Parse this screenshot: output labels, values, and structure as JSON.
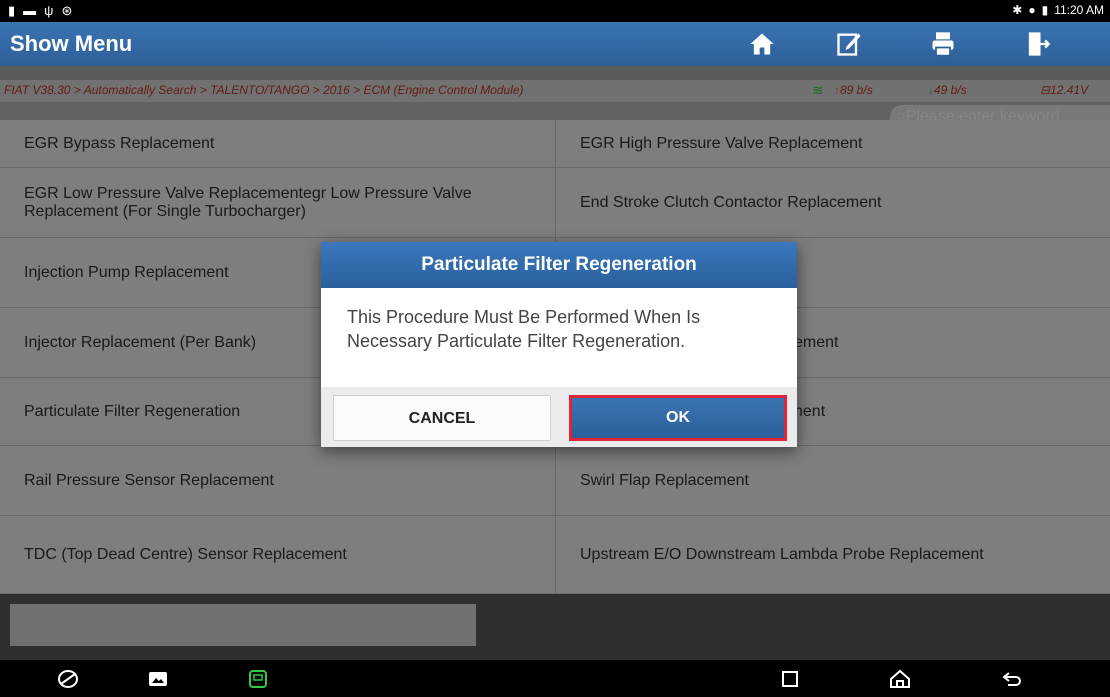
{
  "status_bar": {
    "time": "11:20 AM"
  },
  "header": {
    "title": "Show Menu",
    "buttons": [
      "home-icon",
      "edit-icon",
      "print-icon",
      "exit-icon"
    ]
  },
  "breadcrumb": "FIAT V38.30 > Automatically Search > TALENTO/TANGO > 2016 > ECM (Engine Control Module)",
  "stats": {
    "upload": "89 b/s",
    "download": "49 b/s",
    "voltage": "12.41V"
  },
  "search": {
    "placeholder": "Please enter keyword"
  },
  "menu_items": [
    {
      "left": "EGR Bypass Replacement",
      "right": "EGR High Pressure Valve Replacement"
    },
    {
      "left": "EGR Low Pressure Valve Replacementegr Low Pressure Valve Replacement (For Single Turbocharger)",
      "right": "End Stroke Clutch Contactor Replacement"
    },
    {
      "left": "Injection Pump Replacement",
      "right": ""
    },
    {
      "left": "Injector Replacement (Per Bank)",
      "right": "ement"
    },
    {
      "left": "Particulate Filter Regeneration",
      "right": "nent"
    },
    {
      "left": "Rail Pressure Sensor Replacement",
      "right": "Swirl Flap Replacement"
    },
    {
      "left": "TDC (Top Dead Centre) Sensor Replacement",
      "right": "Upstream E/O Downstream Lambda Probe Replacement"
    }
  ],
  "dialog": {
    "title": "Particulate Filter Regeneration",
    "message": "This Procedure Must Be Performed When Is Necessary Particulate Filter Regeneration.",
    "cancel_label": "CANCEL",
    "ok_label": "OK"
  },
  "colors": {
    "accent": "#2c5f98",
    "breadcrumb": "#c0392b",
    "ok_highlight": "#e0243a"
  }
}
